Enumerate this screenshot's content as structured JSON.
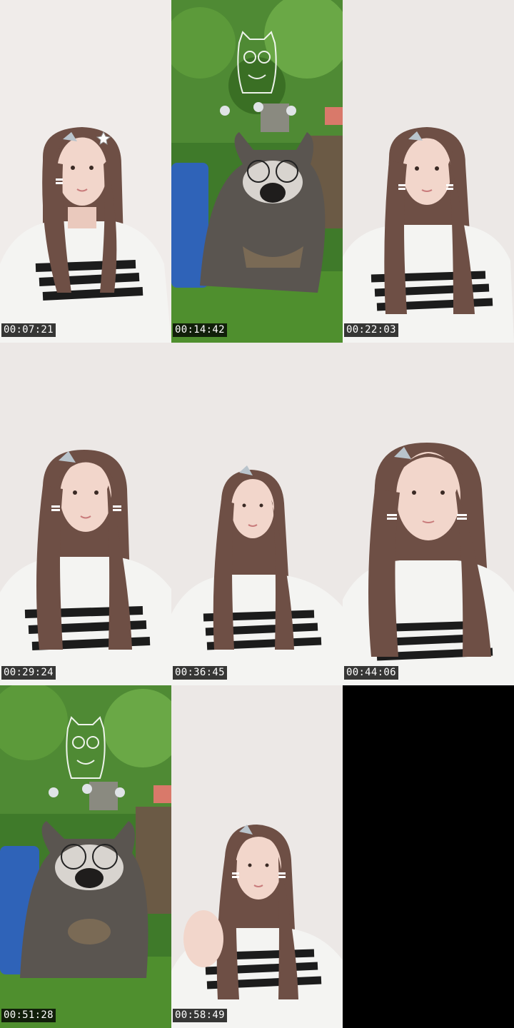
{
  "frames": [
    {
      "timestamp": "00:07:21",
      "scene": "person"
    },
    {
      "timestamp": "00:14:42",
      "scene": "raccoon"
    },
    {
      "timestamp": "00:22:03",
      "scene": "person"
    },
    {
      "timestamp": "00:29:24",
      "scene": "person"
    },
    {
      "timestamp": "00:36:45",
      "scene": "person"
    },
    {
      "timestamp": "00:44:06",
      "scene": "person"
    },
    {
      "timestamp": "00:51:28",
      "scene": "raccoon"
    },
    {
      "timestamp": "00:58:49",
      "scene": "person"
    },
    {
      "timestamp": "",
      "scene": "empty"
    }
  ],
  "colors": {
    "wall": "#ece8e6",
    "hair": "#6e4f45",
    "shirt": "#f4f4f2",
    "stripe": "#1c1c1c",
    "grass": "#4f8f2e",
    "foliage": "#3f7a2a",
    "raccoon_fur": "#5a5550",
    "barrel": "#2f63b8"
  }
}
